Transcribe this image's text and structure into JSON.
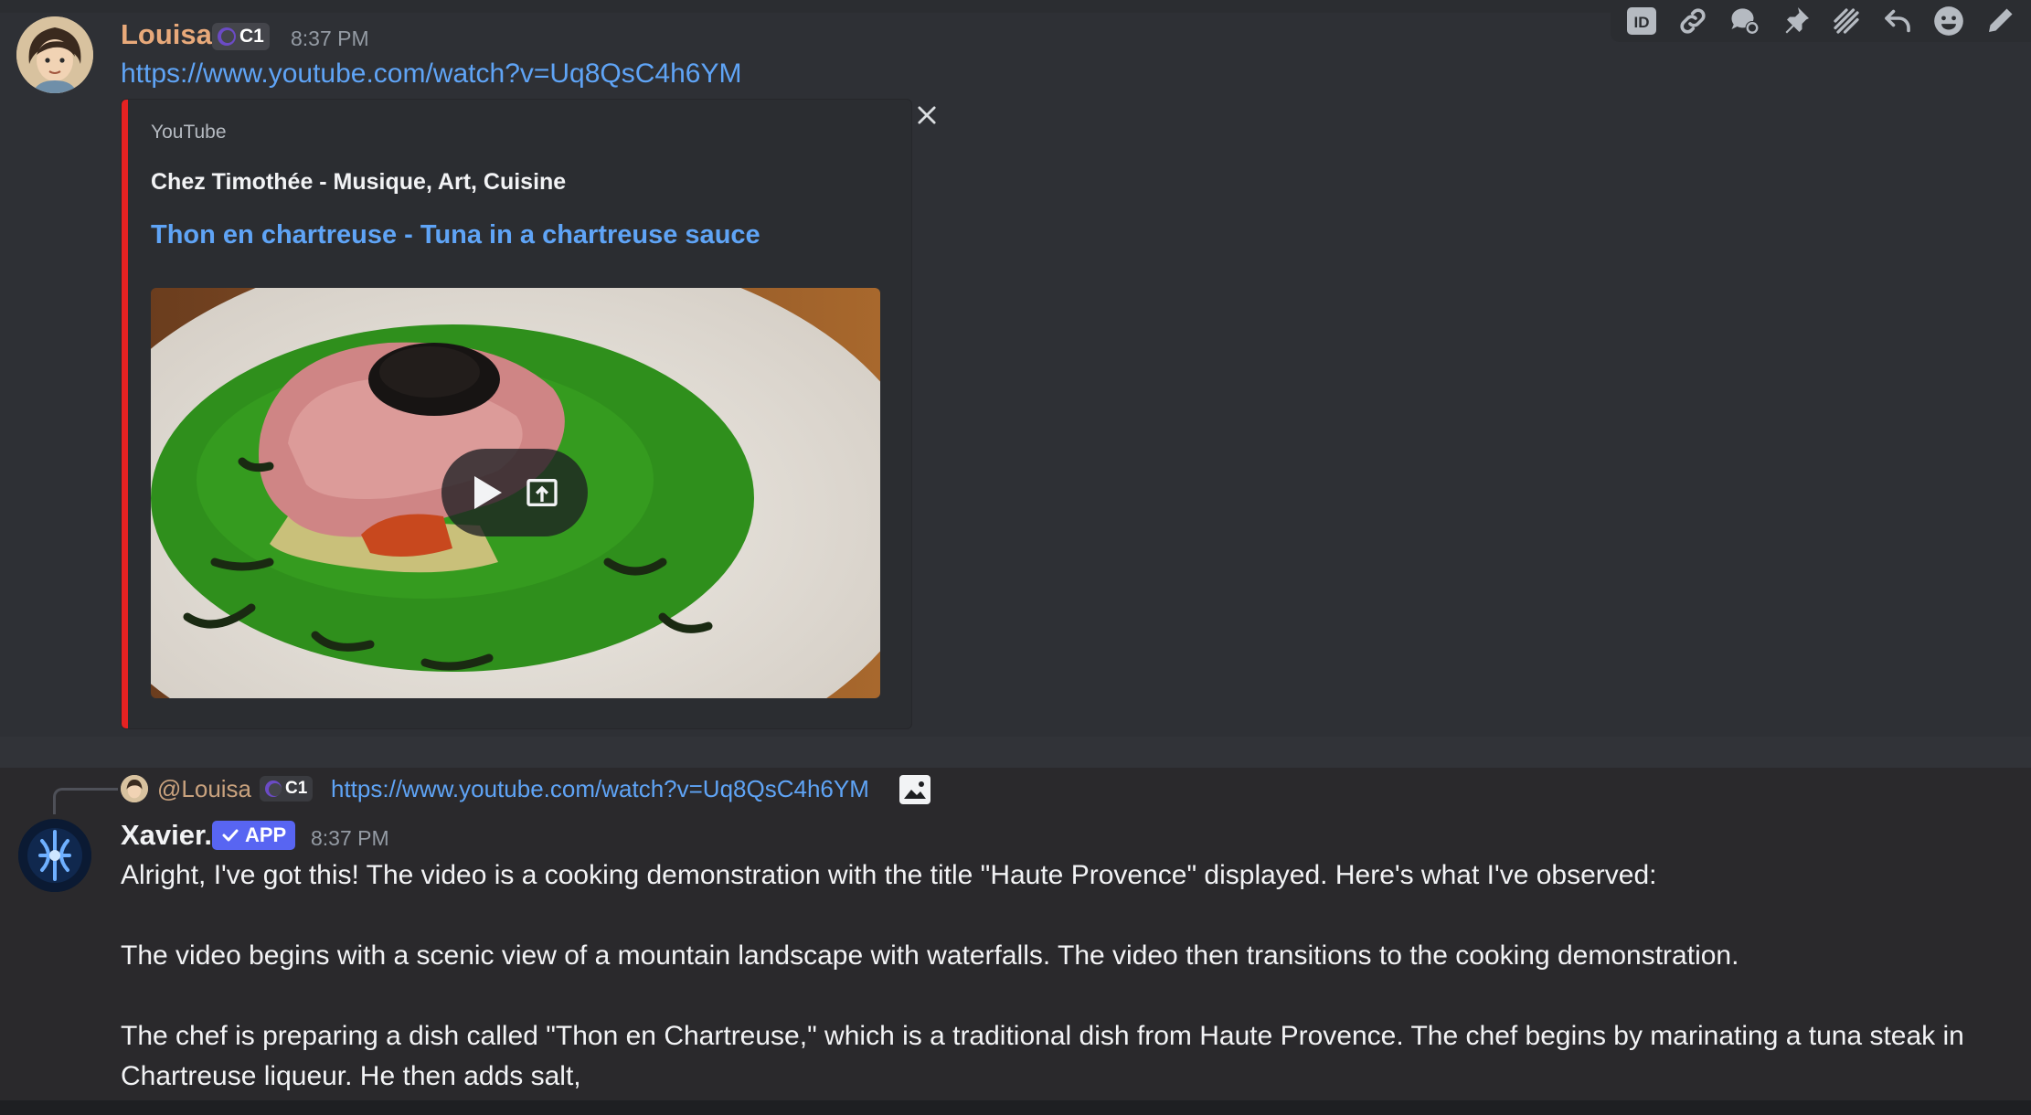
{
  "toolbar": {
    "icons": [
      "id-icon",
      "link-icon",
      "thread-icon",
      "pin-icon",
      "forum-icon",
      "reply-icon",
      "emoji-icon",
      "edit-icon"
    ]
  },
  "message1": {
    "username": "Louisa",
    "role_badge": "C1",
    "timestamp": "8:37 PM",
    "link": "https://www.youtube.com/watch?v=Uq8QsC4h6YM",
    "embed": {
      "provider": "YouTube",
      "author": "Chez Timothée - Musique, Art, Cuisine",
      "title": "Thon en chartreuse - Tuna in a chartreuse sauce",
      "accent_color": "#e52222"
    }
  },
  "message2": {
    "reply": {
      "username": "@Louisa",
      "role_badge": "C1",
      "link": "https://www.youtube.com/watch?v=Uq8QsC4h6YM"
    },
    "username": "Xavier.",
    "app_badge": "APP",
    "timestamp": "8:37 PM",
    "paragraphs": [
      "Alright, I've got this! The video is a cooking demonstration with the title \"Haute Provence\" displayed. Here's what I've observed:",
      "The video begins with a scenic view of a mountain landscape with waterfalls. The video then transitions to the cooking demonstration.",
      "The chef is preparing a dish called \"Thon en Chartreuse,\" which is a traditional dish from Haute Provence. The chef begins by marinating a tuna steak in",
      "Chartreuse liqueur. He then adds salt,"
    ]
  },
  "colors": {
    "link": "#5fa4f6",
    "louisa": "#e8a97a",
    "app_badge": "#5865f2"
  }
}
